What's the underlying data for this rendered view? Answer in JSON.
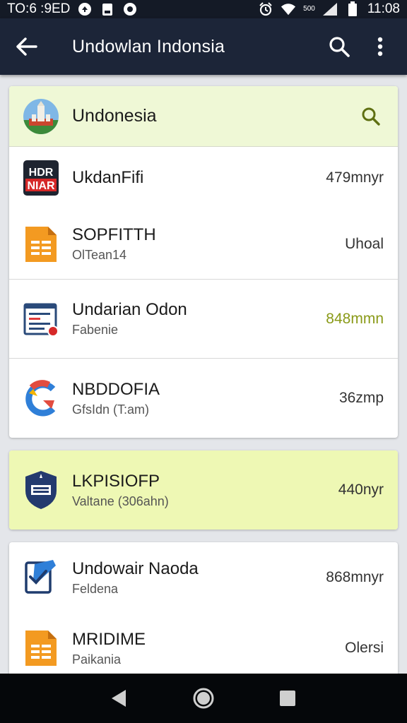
{
  "status_bar": {
    "left_text": "TO:6 :9ED",
    "time": "11:08",
    "small_text": "500",
    "icons": [
      "notification-icon",
      "clipboard-icon",
      "sync-icon",
      "alarm-icon",
      "wifi-icon",
      "signal-icon",
      "battery-icon"
    ]
  },
  "app_bar": {
    "title": "Undowlan Indonsia",
    "back_icon": "arrow-left-icon",
    "search_icon": "search-icon",
    "more_icon": "more-vert-icon"
  },
  "card1": {
    "header": {
      "title": "Undonesia",
      "icon": "landmark-flag-icon",
      "search_icon": "search-icon",
      "accent_color": "#5f7012"
    },
    "rows": [
      {
        "primary": "UkdanFifi",
        "secondary": "",
        "value": "479mnyr",
        "icon": "newspaper-logo-icon",
        "logo_line1": "HDR",
        "logo_line2": "NIAR"
      },
      {
        "primary": "SOPFITTH",
        "secondary": "OlTean14",
        "value": "Uhoal",
        "icon": "orange-doc-icon"
      }
    ]
  },
  "card2": {
    "rows": [
      {
        "primary": "Undarian Odon",
        "secondary": "Fabenie",
        "value": "848mmn",
        "icon": "form-doc-icon",
        "value_color": "#8a9a18"
      }
    ]
  },
  "card3": {
    "rows": [
      {
        "primary": "NBDDOFIA",
        "secondary": "GfsIdn (T:am)",
        "value": "36zmp",
        "icon": "google-g-icon"
      }
    ]
  },
  "card4": {
    "rows": [
      {
        "primary": "LKPISIOFP",
        "secondary": "Valtane (306ahn)",
        "value": "440nyr",
        "icon": "shield-badge-icon"
      }
    ]
  },
  "card5": {
    "rows": [
      {
        "primary": "Undowair Naoda",
        "secondary": "Feldena",
        "value": "868mnyr",
        "icon": "check-doc-icon"
      },
      {
        "primary": "MRIDIME",
        "secondary": "Paikania",
        "value": "Olersi",
        "icon": "orange-doc-icon"
      }
    ]
  },
  "nav_bar": {
    "icons": [
      "back-triangle-icon",
      "home-circle-icon",
      "recents-square-icon"
    ]
  },
  "colors": {
    "app_bar": "#1c2538",
    "status_bar": "#141a26",
    "header_tint": "#eff8d6",
    "highlight_row": "#eef8b4",
    "icon_orange": "#f39a21",
    "icon_blue": "#2a5fa0"
  }
}
